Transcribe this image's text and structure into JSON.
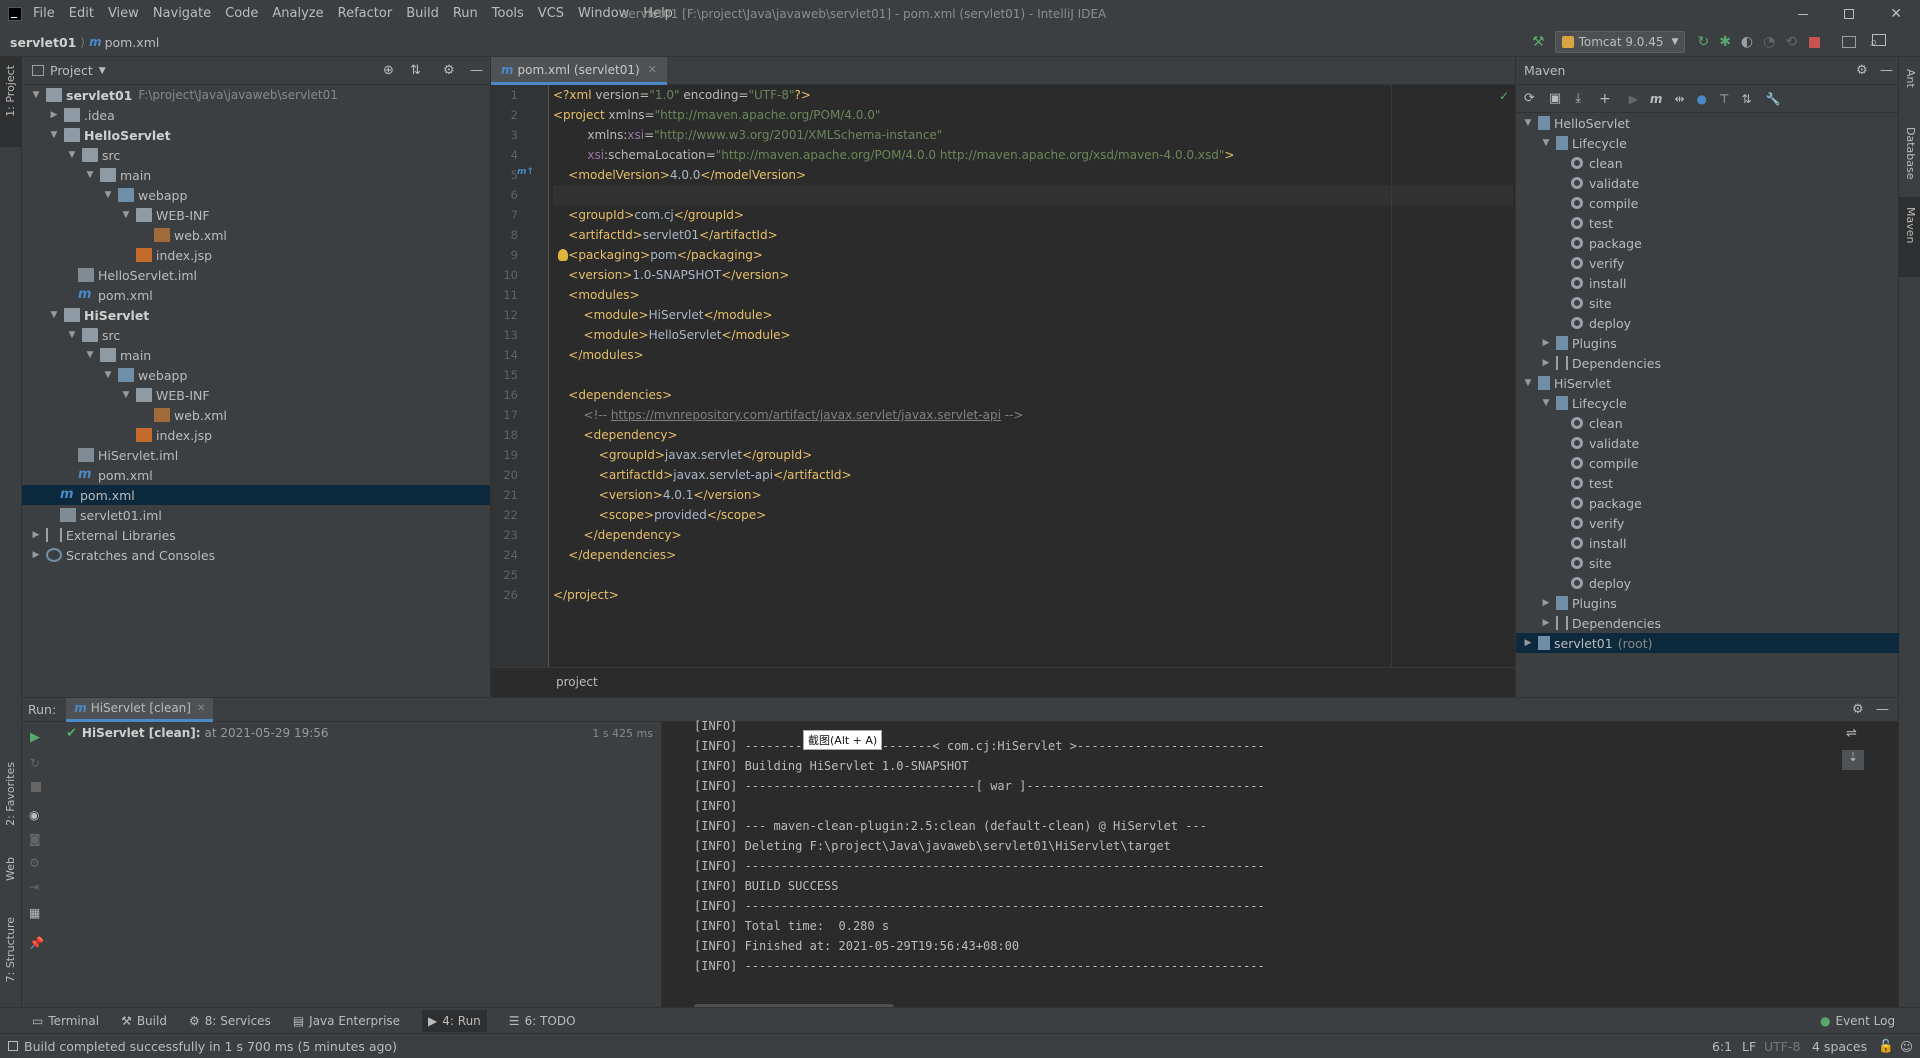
{
  "menubar": {
    "items": [
      "File",
      "Edit",
      "View",
      "Navigate",
      "Code",
      "Analyze",
      "Refactor",
      "Build",
      "Run",
      "Tools",
      "VCS",
      "Window",
      "Help"
    ],
    "window_title": "servlet01 [F:\\project\\Java\\javaweb\\servlet01] - pom.xml (servlet01) - IntelliJ IDEA"
  },
  "navbar": {
    "crumbs": [
      "servlet01",
      "pom.xml"
    ],
    "run_config": "Tomcat 9.0.45"
  },
  "left_strip": {
    "project": "1: Project",
    "favorites": "2: Favorites",
    "web": "Web",
    "structure": "7: Structure"
  },
  "right_strip": {
    "ant": "Ant",
    "database": "Database",
    "maven": "Maven"
  },
  "project": {
    "title": "Project",
    "tree": [
      {
        "label": "servlet01",
        "extra": "F:\\project\\Java\\javaweb\\servlet01"
      },
      {
        "label": ".idea"
      },
      {
        "label": "HelloServlet"
      },
      {
        "label": "src"
      },
      {
        "label": "main"
      },
      {
        "label": "webapp"
      },
      {
        "label": "WEB-INF"
      },
      {
        "label": "web.xml"
      },
      {
        "label": "index.jsp"
      },
      {
        "label": "HelloServlet.iml"
      },
      {
        "label": "pom.xml"
      },
      {
        "label": "HiServlet"
      },
      {
        "label": "src"
      },
      {
        "label": "main"
      },
      {
        "label": "webapp"
      },
      {
        "label": "WEB-INF"
      },
      {
        "label": "web.xml"
      },
      {
        "label": "index.jsp"
      },
      {
        "label": "HiServlet.iml"
      },
      {
        "label": "pom.xml"
      },
      {
        "label": "pom.xml"
      },
      {
        "label": "servlet01.iml"
      },
      {
        "label": "External Libraries"
      },
      {
        "label": "Scratches and Consoles"
      }
    ]
  },
  "editor": {
    "tab": "pom.xml (servlet01)",
    "line_numbers": [
      "1",
      "2",
      "3",
      "4",
      "5",
      "6",
      "7",
      "8",
      "9",
      "10",
      "11",
      "12",
      "13",
      "14",
      "15",
      "16",
      "17",
      "18",
      "19",
      "20",
      "21",
      "22",
      "23",
      "24",
      "25",
      "26"
    ],
    "lines": [
      "<?xml version=\"1.0\" encoding=\"UTF-8\"?>",
      "<project xmlns=\"http://maven.apache.org/POM/4.0.0\"",
      "         xmlns:xsi=\"http://www.w3.org/2001/XMLSchema-instance\"",
      "         xsi:schemaLocation=\"http://maven.apache.org/POM/4.0.0 http://maven.apache.org/xsd/maven-4.0.0.xsd\">",
      "    <modelVersion>4.0.0</modelVersion>",
      "",
      "    <groupId>com.cj</groupId>",
      "    <artifactId>servlet01</artifactId>",
      "    <packaging>pom</packaging>",
      "    <version>1.0-SNAPSHOT</version>",
      "    <modules>",
      "        <module>HiServlet</module>",
      "        <module>HelloServlet</module>",
      "    </modules>",
      "",
      "    <dependencies>",
      "        <!-- https://mvnrepository.com/artifact/javax.servlet/javax.servlet-api -->",
      "        <dependency>",
      "            <groupId>javax.servlet</groupId>",
      "            <artifactId>javax.servlet-api</artifactId>",
      "            <version>4.0.1</version>",
      "            <scope>provided</scope>",
      "        </dependency>",
      "    </dependencies>",
      "",
      "</project>"
    ],
    "breadcrumb": "project"
  },
  "maven": {
    "title": "Maven",
    "rows": [
      "HelloServlet",
      "Lifecycle",
      "clean",
      "validate",
      "compile",
      "test",
      "package",
      "verify",
      "install",
      "site",
      "deploy",
      "Plugins",
      "Dependencies",
      "HiServlet",
      "Lifecycle",
      "clean",
      "validate",
      "compile",
      "test",
      "package",
      "verify",
      "install",
      "site",
      "deploy",
      "Plugins",
      "Dependencies",
      "servlet01"
    ],
    "root_suffix": "(root)"
  },
  "run": {
    "label": "Run:",
    "tab": "HiServlet [clean]",
    "item_label": "HiServlet [clean]:",
    "item_time": "at 2021-05-29 19:56",
    "item_duration": "1 s 425 ms",
    "tooltip": "截图(Alt + A)",
    "output": [
      "[INFO]",
      "[INFO] --------------------------< com.cj:HiServlet >--------------------------",
      "[INFO] Building HiServlet 1.0-SNAPSHOT",
      "[INFO] --------------------------------[ war ]---------------------------------",
      "[INFO]",
      "[INFO] --- maven-clean-plugin:2.5:clean (default-clean) @ HiServlet ---",
      "[INFO] Deleting F:\\project\\Java\\javaweb\\servlet01\\HiServlet\\target",
      "[INFO] ------------------------------------------------------------------------",
      "[INFO] BUILD SUCCESS",
      "[INFO] ------------------------------------------------------------------------",
      "[INFO] Total time:  0.280 s",
      "[INFO] Finished at: 2021-05-29T19:56:43+08:00",
      "[INFO] ------------------------------------------------------------------------"
    ]
  },
  "bottom_tabs": {
    "terminal": "Terminal",
    "build": "Build",
    "services": "8: Services",
    "java_enterprise": "Java Enterprise",
    "run": "4: Run",
    "todo": "6: TODO",
    "event_log": "Event Log"
  },
  "status": {
    "message": "Build completed successfully in 1 s 700 ms (5 minutes ago)",
    "position": "6:1",
    "line_sep": "LF",
    "encoding": "UTF-8",
    "indent": "4 spaces"
  },
  "colors": {
    "accent": "#4a88c7",
    "selection": "#0d293e",
    "success": "#59a869",
    "tag": "#e8bf6a",
    "attr_value": "#6a8759"
  }
}
